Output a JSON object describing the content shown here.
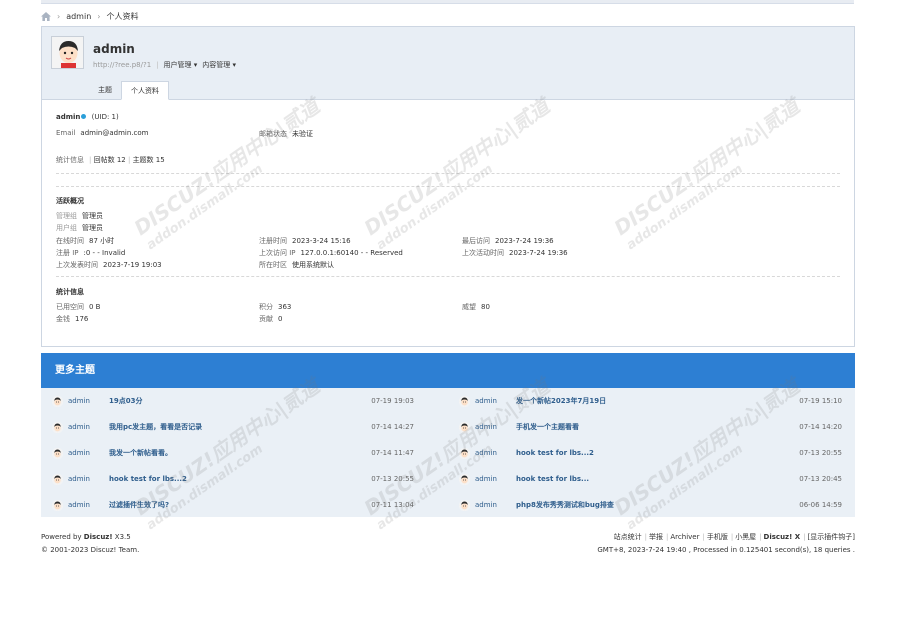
{
  "breadcrumb": {
    "items": [
      "admin",
      "个人资料"
    ],
    "separator": "›"
  },
  "profile": {
    "username": "admin",
    "url": "http://?ree.p8/?1",
    "menus": [
      "用户管理",
      "内容管理"
    ],
    "tabs": [
      {
        "label": "主题",
        "active": false
      },
      {
        "label": "个人资料",
        "active": true
      }
    ],
    "uid_name": "admin",
    "uid_text": "(UID: 1)",
    "email_label": "Email",
    "email_value": "admin@admin.com",
    "email_status_label": "邮箱状态",
    "email_status_value": "未验证",
    "stats_label": "统计信息",
    "posts_label": "回帖数 12",
    "threads_label": "主题数 15",
    "activity_title": "活跃概况",
    "admin_group_label": "管理组",
    "admin_group_value": "管理员",
    "user_group_label": "用户组",
    "user_group_value": "管理员",
    "online_label": "在线时间",
    "online_value": "87 小时",
    "reg_time_label": "注册时间",
    "reg_time_value": "2023-3-24 15:16",
    "last_visit_label": "最后访问",
    "last_visit_value": "2023-7-24 19:36",
    "reg_ip_label": "注册 IP",
    "reg_ip_value": ":0 - - Invalid",
    "last_ip_label": "上次访问 IP",
    "last_ip_value": "127.0.0.1:60140 - - Reserved",
    "last_active_label": "上次活动时间",
    "last_active_value": "2023-7-24 19:36",
    "last_post_label": "上次发表时间",
    "last_post_value": "2023-7-19 19:03",
    "timezone_label": "所在时区",
    "timezone_value": "使用系统默认",
    "stats_title": "统计信息",
    "space_label": "已用空间",
    "space_value": "0 B",
    "credits_label": "积分",
    "credits_value": "363",
    "prestige_label": "威望",
    "prestige_value": "80",
    "money_label": "金钱",
    "money_value": "176",
    "contrib_label": "贡献",
    "contrib_value": "0"
  },
  "more": {
    "title": "更多主题",
    "threads": [
      {
        "user": "admin",
        "title": "19点03分",
        "date": "07-19 19:03"
      },
      {
        "user": "admin",
        "title": "发一个新帖2023年7月19日",
        "date": "07-19 15:10"
      },
      {
        "user": "admin",
        "title": "我用pc发主题，看看是否记录",
        "date": "07-14 14:27"
      },
      {
        "user": "admin",
        "title": "手机发一个主题看看",
        "date": "07-14 14:20"
      },
      {
        "user": "admin",
        "title": "我发一个新帖看看。",
        "date": "07-14 11:47"
      },
      {
        "user": "admin",
        "title": "hook test for lbs...2",
        "date": "07-13 20:55"
      },
      {
        "user": "admin",
        "title": "hook test for lbs...2",
        "date": "07-13 20:55"
      },
      {
        "user": "admin",
        "title": "hook test for lbs...",
        "date": "07-13 20:45"
      },
      {
        "user": "admin",
        "title": "过滤插件生效了吗?",
        "date": "07-11 13:04"
      },
      {
        "user": "admin",
        "title": "php8发布秀秀测试和bug排查",
        "date": "06-06 14:59"
      }
    ]
  },
  "footer": {
    "powered_prefix": "Powered by ",
    "powered_brand": "Discuz!",
    "powered_version": " X3.5",
    "copyright": "© 2001-2023 Discuz! Team.",
    "links": [
      "站点统计",
      "举报",
      "Archiver",
      "手机版",
      "小黑屋",
      "Discuz! X",
      "[显示插件钩子]"
    ],
    "status": "GMT+8, 2023-7-24 19:40 , Processed in 0.125401 second(s), 18 queries ."
  },
  "watermark_lines": [
    "DISCUZ!应用中心|贰道",
    "addon.dismall.com"
  ],
  "colors": {
    "accent": "#2d7fd3",
    "link": "#2e5d8c",
    "online": "#2b9fd9",
    "panel": "#e8eef5"
  }
}
